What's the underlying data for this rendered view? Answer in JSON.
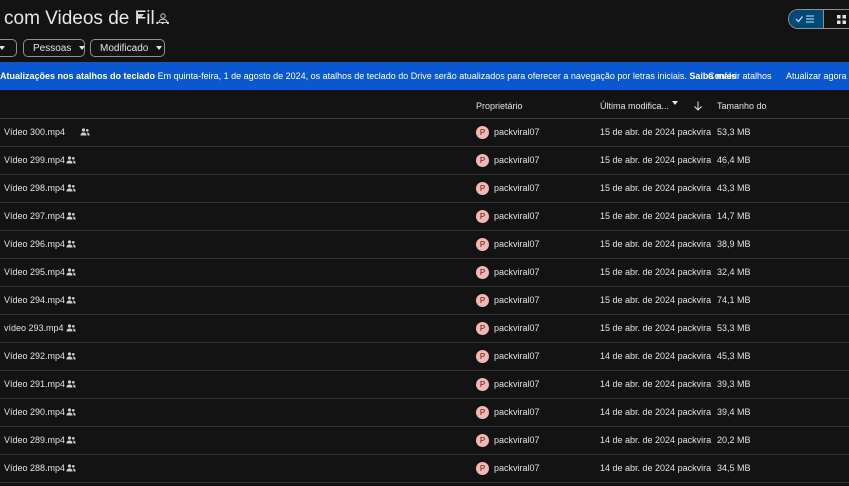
{
  "header": {
    "title": "com Videos de Fil...",
    "shared_icon": "people-icon"
  },
  "view_toggle": {
    "list_icon": "check-list-icon",
    "grid_icon": "grid-icon"
  },
  "filters": [
    {
      "label": ""
    },
    {
      "label": "Pessoas"
    },
    {
      "label": "Modificado"
    }
  ],
  "banner": {
    "title": "Atualizações nos atalhos do teclado",
    "text": "Em quinta-feira, 1 de agosto de 2024, os atalhos de teclado do Drive serão atualizados para oferecer a navegação por letras iniciais.",
    "link": "Saiba mais",
    "button_check": "Conferir atalhos",
    "button_update": "Atualizar agora"
  },
  "columns": {
    "owner": "Proprietário",
    "modified": "Última modifica...",
    "size": "Tamanho do"
  },
  "rows": [
    {
      "name": "Vídeo 300.mp4",
      "avatar": "P",
      "owner": "packviral07",
      "modified": "15 de abr. de 2024 packvira",
      "size": "53,3 MB"
    },
    {
      "name": "Vídeo 299.mp4",
      "avatar": "P",
      "owner": "packviral07",
      "modified": "15 de abr. de 2024 packvira",
      "size": "46,4 MB"
    },
    {
      "name": "Vídeo 298.mp4",
      "avatar": "P",
      "owner": "packviral07",
      "modified": "15 de abr. de 2024 packvira",
      "size": "43,3 MB"
    },
    {
      "name": "Vídeo 297.mp4",
      "avatar": "P",
      "owner": "packviral07",
      "modified": "15 de abr. de 2024 packvira",
      "size": "14,7 MB"
    },
    {
      "name": "Vídeo 296.mp4",
      "avatar": "P",
      "owner": "packviral07",
      "modified": "15 de abr. de 2024 packvira",
      "size": "38,9 MB"
    },
    {
      "name": "Vídeo 295.mp4",
      "avatar": "P",
      "owner": "packviral07",
      "modified": "15 de abr. de 2024 packvira",
      "size": "32,4 MB"
    },
    {
      "name": "Vídeo 294.mp4",
      "avatar": "P",
      "owner": "packviral07",
      "modified": "15 de abr. de 2024 packvira",
      "size": "74,1 MB"
    },
    {
      "name": "vídeo 293.mp4",
      "avatar": "P",
      "owner": "packviral07",
      "modified": "15 de abr. de 2024 packvira",
      "size": "53,3 MB"
    },
    {
      "name": "Vídeo 292.mp4",
      "avatar": "P",
      "owner": "packviral07",
      "modified": "14 de abr. de 2024 packvira",
      "size": "45,3 MB"
    },
    {
      "name": "Vídeo 291.mp4",
      "avatar": "P",
      "owner": "packviral07",
      "modified": "14 de abr. de 2024 packvira",
      "size": "39,3 MB"
    },
    {
      "name": "Vídeo 290.mp4",
      "avatar": "P",
      "owner": "packviral07",
      "modified": "14 de abr. de 2024 packvira",
      "size": "39,4 MB"
    },
    {
      "name": "Vídeo 289.mp4",
      "avatar": "P",
      "owner": "packviral07",
      "modified": "14 de abr. de 2024 packvira",
      "size": "20,2 MB"
    },
    {
      "name": "Vídeo 288.mp4",
      "avatar": "P",
      "owner": "packviral07",
      "modified": "14 de abr. de 2024 packvira",
      "size": "34,5 MB"
    }
  ],
  "colors": {
    "background": "#131313",
    "banner": "#0b57d0",
    "avatar": "#f2b8b5",
    "toggle_active": "#004a77"
  }
}
